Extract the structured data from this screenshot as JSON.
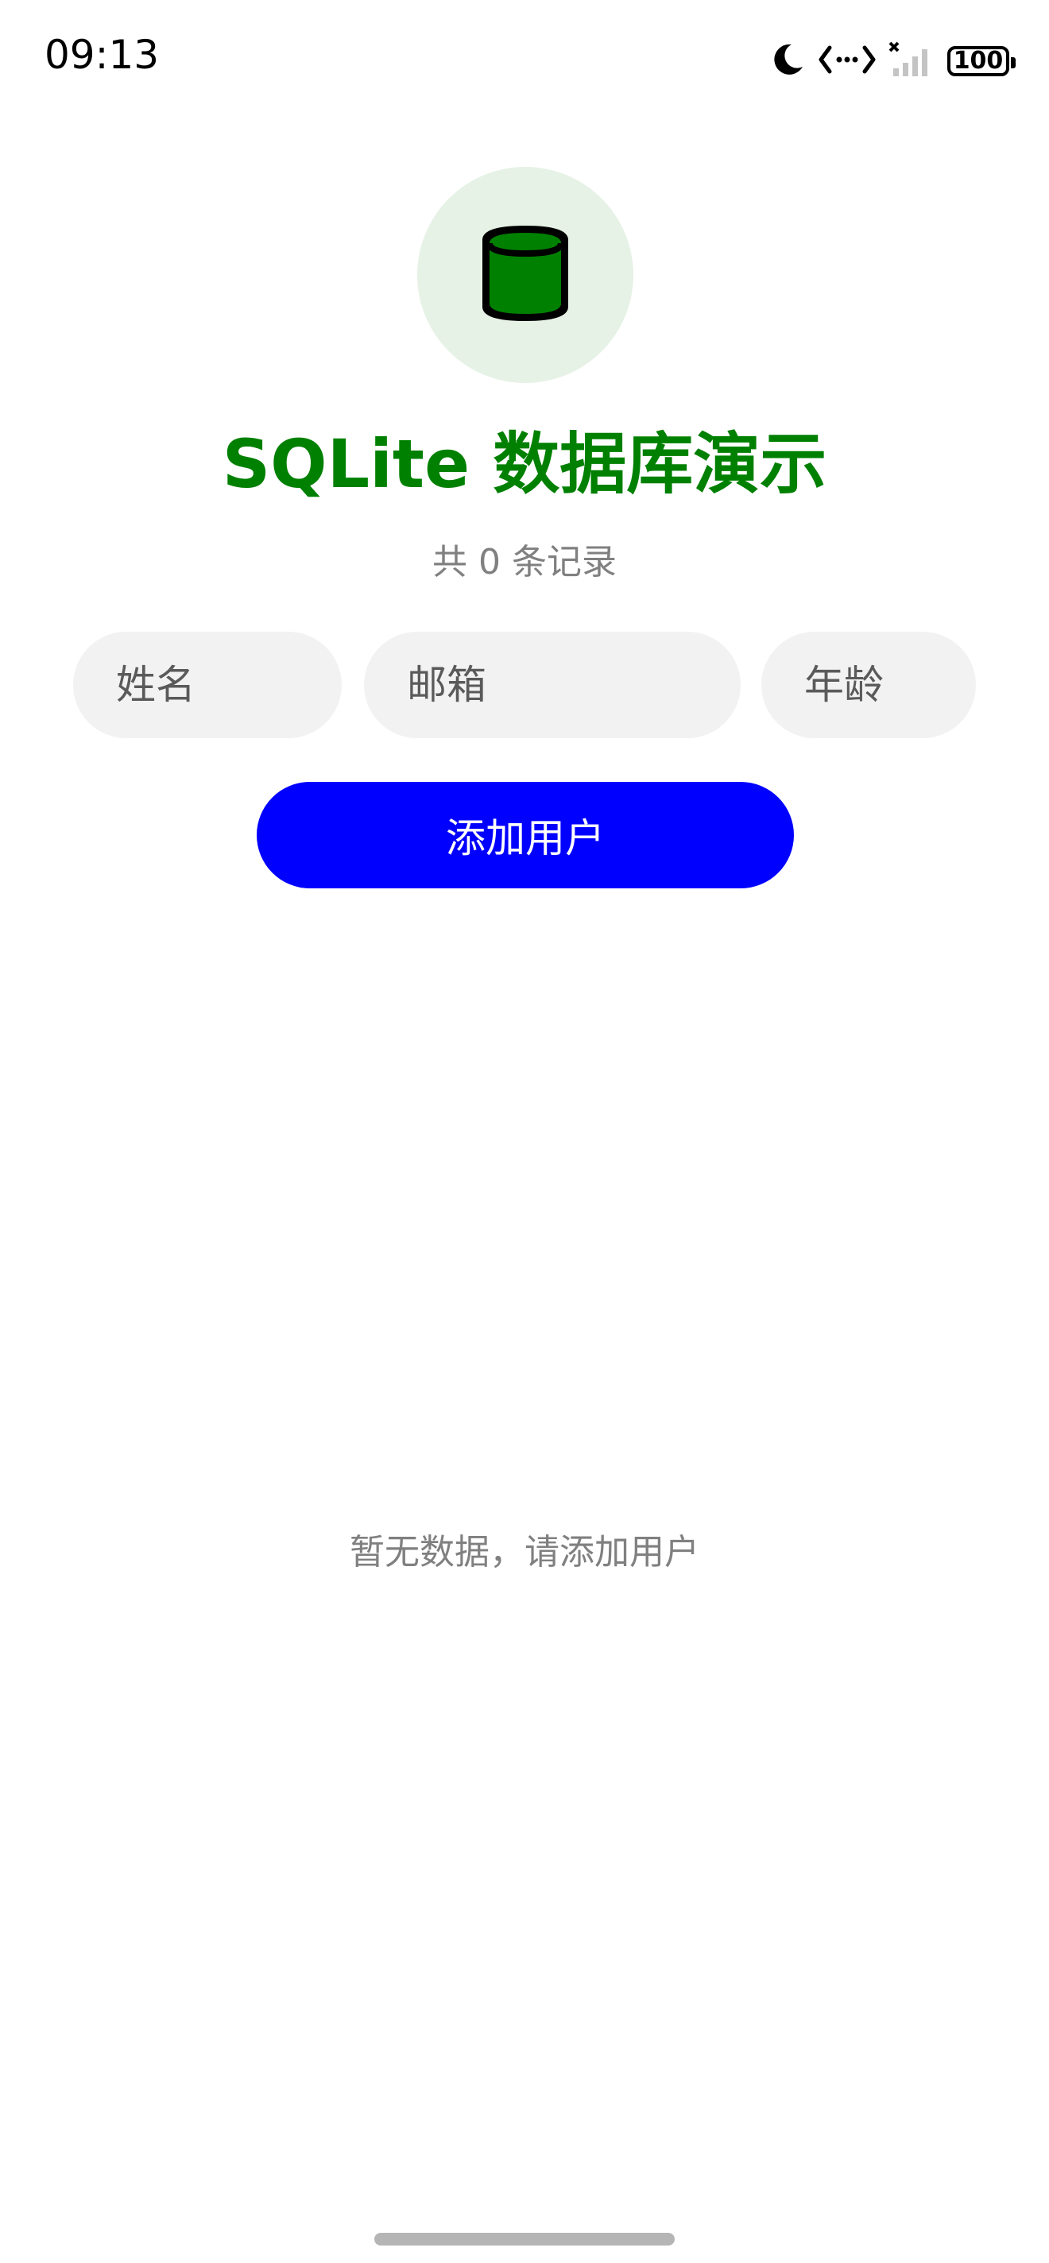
{
  "status_bar": {
    "time": "09:13",
    "battery_level": "100",
    "icons": [
      "moon-icon",
      "data-transfer-icon",
      "signal-icon",
      "battery-icon"
    ]
  },
  "header": {
    "logo_icon": "database-icon",
    "title": "SQLite 数据库演示",
    "record_count_text": "共 0 条记录"
  },
  "form": {
    "name_placeholder": "姓名",
    "email_placeholder": "邮箱",
    "age_placeholder": "年龄",
    "add_button_label": "添加用户"
  },
  "list": {
    "empty_message": "暂无数据，请添加用户"
  },
  "colors": {
    "title": "#008000",
    "logo_bg": "#e6f2e6",
    "button_bg": "#0000ff",
    "input_bg": "#f2f2f2",
    "muted_text": "#808080"
  }
}
